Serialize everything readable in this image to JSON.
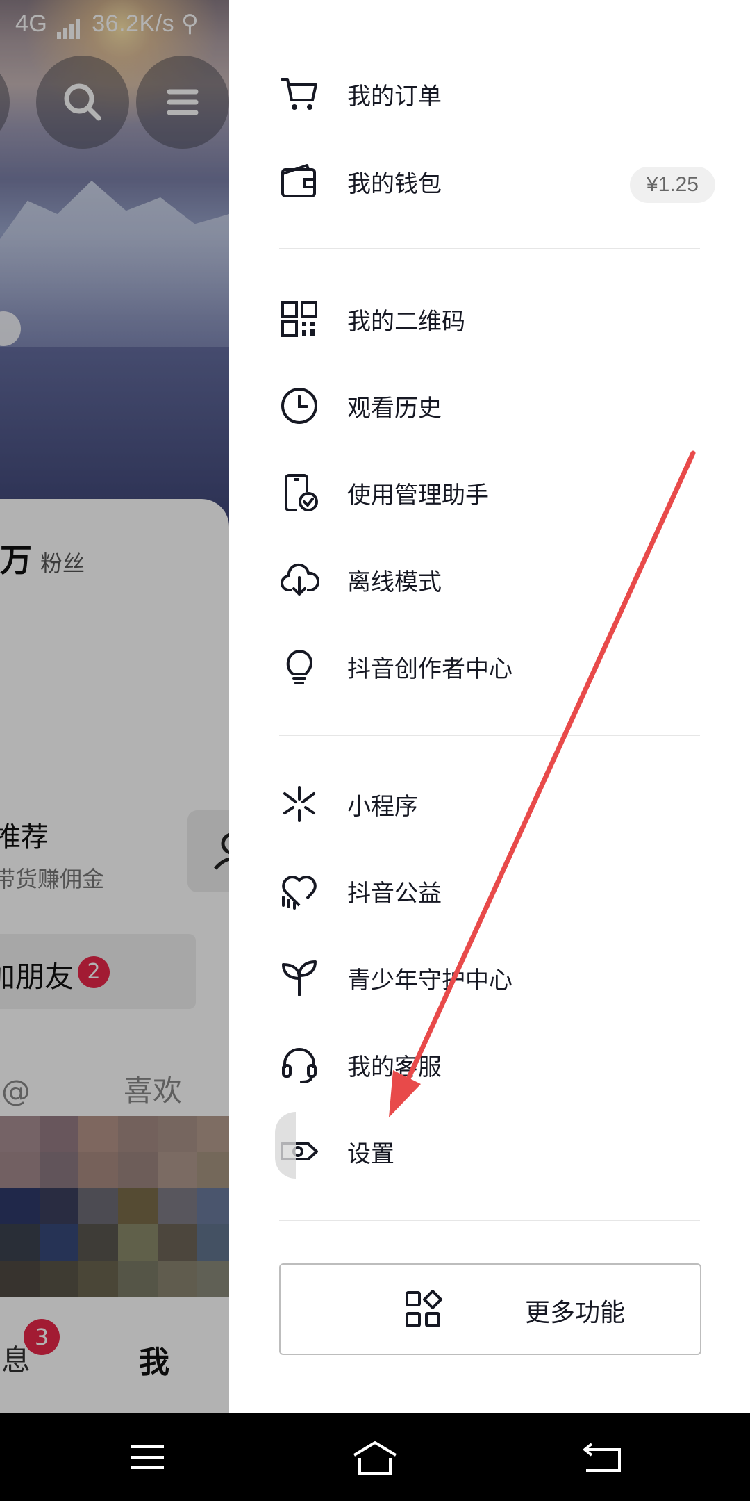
{
  "status_bar": {
    "network": "4G",
    "speed": "36.2K/s"
  },
  "background_app": {
    "followers_number": "万",
    "followers_label": "粉丝",
    "recommend_title": "推荐",
    "recommend_sub": "带货赚佣金",
    "friends_label": "加朋友",
    "friends_badge": "2",
    "tab_mentions": "被@",
    "tab_likes": "喜欢",
    "bottom_messages": "消息",
    "bottom_messages_badge": "3",
    "bottom_me": "我"
  },
  "drawer": {
    "items": [
      {
        "label": "我的订单",
        "icon": "cart-icon"
      },
      {
        "label": "我的钱包",
        "icon": "wallet-icon",
        "badge": "¥1.25"
      },
      {
        "label": "我的二维码",
        "icon": "qr-code-icon"
      },
      {
        "label": "观看历史",
        "icon": "clock-icon"
      },
      {
        "label": "使用管理助手",
        "icon": "phone-check-icon"
      },
      {
        "label": "离线模式",
        "icon": "cloud-download-icon"
      },
      {
        "label": "抖音创作者中心",
        "icon": "lightbulb-icon"
      },
      {
        "label": "小程序",
        "icon": "mini-program-icon"
      },
      {
        "label": "抖音公益",
        "icon": "heart-charity-icon"
      },
      {
        "label": "青少年守护中心",
        "icon": "sprout-icon"
      },
      {
        "label": "我的客服",
        "icon": "headset-icon"
      },
      {
        "label": "设置",
        "icon": "settings-icon"
      }
    ],
    "more_button": "更多功能"
  },
  "colors": {
    "annotation_arrow": "#e84a4a",
    "badge_red": "#e8284a",
    "text_primary": "#161823"
  }
}
